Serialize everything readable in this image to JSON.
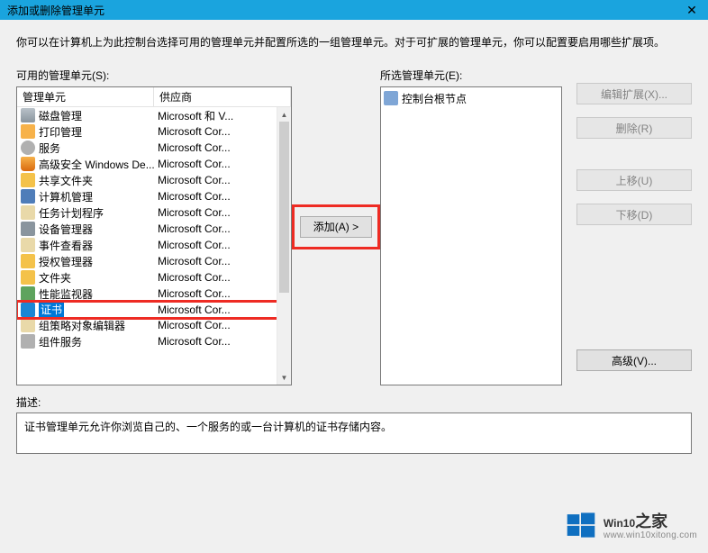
{
  "title": "添加或删除管理单元",
  "intro": "你可以在计算机上为此控制台选择可用的管理单元并配置所选的一组管理单元。对于可扩展的管理单元，你可以配置要启用哪些扩展项。",
  "available_label": "可用的管理单元(S):",
  "selected_label": "所选管理单元(E):",
  "columns": {
    "snapins": "管理单元",
    "vendor": "供应商"
  },
  "snapins": [
    {
      "name": "磁盘管理",
      "vendor": "Microsoft 和 V...",
      "icon": "ic-disk"
    },
    {
      "name": "打印管理",
      "vendor": "Microsoft Cor...",
      "icon": "ic-print"
    },
    {
      "name": "服务",
      "vendor": "Microsoft Cor...",
      "icon": "ic-serv"
    },
    {
      "name": "高级安全 Windows De...",
      "vendor": "Microsoft Cor...",
      "icon": "ic-shield"
    },
    {
      "name": "共享文件夹",
      "vendor": "Microsoft Cor...",
      "icon": "ic-share"
    },
    {
      "name": "计算机管理",
      "vendor": "Microsoft Cor...",
      "icon": "ic-comp"
    },
    {
      "name": "任务计划程序",
      "vendor": "Microsoft Cor...",
      "icon": "ic-task"
    },
    {
      "name": "设备管理器",
      "vendor": "Microsoft Cor...",
      "icon": "ic-dev"
    },
    {
      "name": "事件查看器",
      "vendor": "Microsoft Cor...",
      "icon": "ic-evt"
    },
    {
      "name": "授权管理器",
      "vendor": "Microsoft Cor...",
      "icon": "ic-auth"
    },
    {
      "name": "文件夹",
      "vendor": "Microsoft Cor...",
      "icon": "ic-folder"
    },
    {
      "name": "性能监视器",
      "vendor": "Microsoft Cor...",
      "icon": "ic-perf"
    },
    {
      "name": "证书",
      "vendor": "Microsoft Cor...",
      "icon": "ic-cert",
      "selected": true,
      "highlighted": true
    },
    {
      "name": "组策略对象编辑器",
      "vendor": "Microsoft Cor...",
      "icon": "ic-gpo"
    },
    {
      "name": "组件服务",
      "vendor": "Microsoft Cor...",
      "icon": "ic-compserv"
    }
  ],
  "root_node": "控制台根节点",
  "add_button": "添加(A) >",
  "side_buttons": {
    "edit_ext": "编辑扩展(X)...",
    "remove": "删除(R)",
    "move_up": "上移(U)",
    "move_down": "下移(D)",
    "advanced": "高级(V)..."
  },
  "desc_label": "描述:",
  "description": "证书管理单元允许你浏览自己的、一个服务的或一台计算机的证书存储内容。",
  "watermark": {
    "brand": "Win10",
    "suffix": "之家",
    "url": "www.win10xitong.com"
  }
}
